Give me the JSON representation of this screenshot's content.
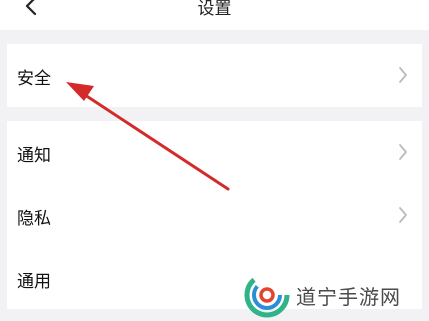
{
  "header": {
    "title": "设置",
    "back_icon": "chevron-left-icon"
  },
  "settings": {
    "items": [
      {
        "label": "安全",
        "chevron": "chevron-right-icon"
      },
      {
        "label": "通知",
        "chevron": "chevron-right-icon"
      },
      {
        "label": "隐私",
        "chevron": "chevron-right-icon"
      },
      {
        "label": "通用"
      }
    ]
  },
  "annotation": {
    "type": "red-arrow",
    "color": "#d42a2a"
  },
  "watermark": {
    "text": "道宁手游网",
    "logo": "swirl-logo-icon"
  }
}
